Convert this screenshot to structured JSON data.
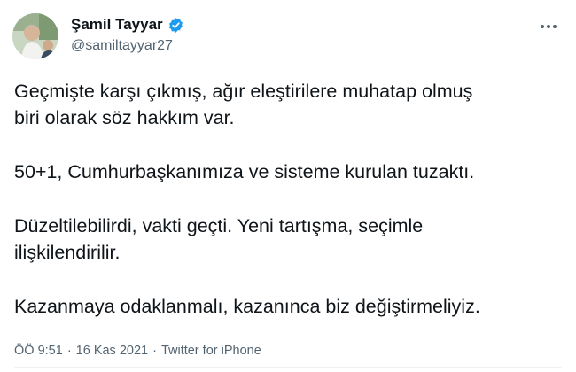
{
  "tweet": {
    "author": {
      "display_name": "Şamil Tayyar",
      "handle": "@samiltayyar27",
      "verified": true,
      "verified_color": "#1d9bf0"
    },
    "more_icon": "more-horizontal-icon",
    "paragraphs": [
      "Geçmişte karşı çıkmış, ağır eleştirilere muhatap olmuş\nbiri olarak söz hakkım var.",
      "50+1, Cumhurbaşkanımıza ve sisteme kurulan tuzaktı.",
      "Düzeltilebilirdi, vakti geçti. Yeni tartışma, seçimle\nilişkilendirilir.",
      "Kazanmaya odaklanmalı, kazanınca biz değiştirmeliyiz."
    ],
    "meta": {
      "time": "ÖÖ 9:51",
      "separator": "·",
      "date": "16 Kas 2021",
      "source": "Twitter for iPhone"
    }
  }
}
